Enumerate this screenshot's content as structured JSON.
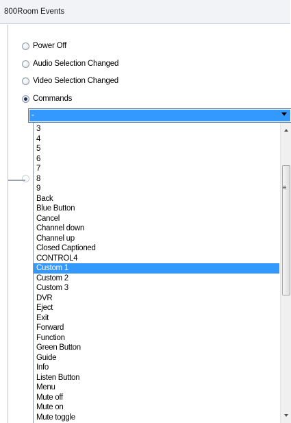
{
  "window": {
    "title": "800Room Events"
  },
  "events": [
    {
      "label": "Power Off",
      "checked": false
    },
    {
      "label": "Audio Selection Changed",
      "checked": false
    },
    {
      "label": "Video Selection Changed",
      "checked": false
    },
    {
      "label": "Commands",
      "checked": true
    }
  ],
  "combo": {
    "value": "-"
  },
  "dropdown": {
    "items": [
      "3",
      "4",
      "5",
      "6",
      "7",
      "8",
      "9",
      "Back",
      "Blue Button",
      "Cancel",
      "Channel down",
      "Channel up",
      "Closed Captioned",
      "CONTROL4",
      "Custom 1",
      "Custom 2",
      "Custom 3",
      "DVR",
      "Eject",
      "Exit",
      "Forward",
      "Function",
      "Green Button",
      "Guide",
      "Info",
      "Listen Button",
      "Menu",
      "Mute off",
      "Mute on",
      "Mute toggle"
    ],
    "selected": "Custom 1"
  },
  "colors": {
    "selection": "#3399ff",
    "title_bg": "#f1f3f6"
  }
}
